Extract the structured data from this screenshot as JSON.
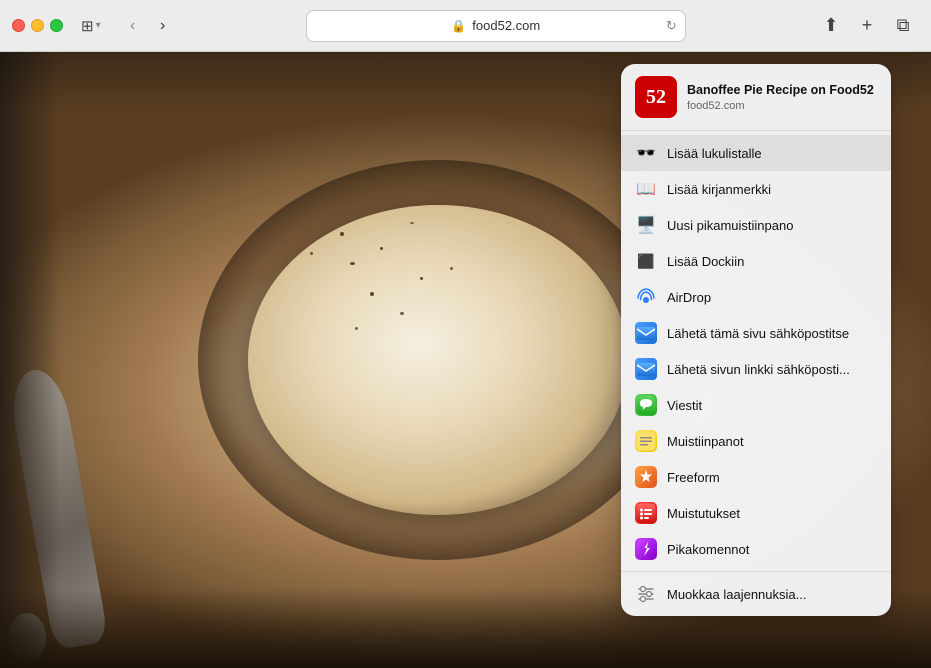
{
  "browser": {
    "url": "food52.com",
    "nav": {
      "back_label": "‹",
      "forward_label": "›"
    }
  },
  "toolbar": {
    "share_label": "⬆",
    "new_tab_label": "+",
    "tab_view_label": "⧉",
    "sidebar_label": "⊞",
    "sidebar_dropdown": "▾"
  },
  "page_preview": {
    "icon_text": "52",
    "title": "Banoffee Pie Recipe on Food52",
    "url": "food52.com"
  },
  "menu": {
    "items": [
      {
        "id": "reading-list",
        "label": "Lisää lukulistalle",
        "icon_type": "glasses",
        "highlighted": true
      },
      {
        "id": "bookmark",
        "label": "Lisää kirjanmerkki",
        "icon_type": "book"
      },
      {
        "id": "quick-note",
        "label": "Uusi pikamuistiinpano",
        "icon_type": "monitor"
      },
      {
        "id": "add-dock",
        "label": "Lisää Dockiin",
        "icon_type": "dock"
      },
      {
        "id": "airdrop",
        "label": "AirDrop",
        "icon_type": "airdrop"
      },
      {
        "id": "mail-page",
        "label": "Lähetä tämä sivu sähköpostitse",
        "icon_type": "mail-page"
      },
      {
        "id": "mail-link",
        "label": "Lähetä sivun linkki sähköposti...",
        "icon_type": "mail-link"
      },
      {
        "id": "messages",
        "label": "Viestit",
        "icon_type": "messages"
      },
      {
        "id": "notes",
        "label": "Muistiinpanot",
        "icon_type": "notes"
      },
      {
        "id": "freeform",
        "label": "Freeform",
        "icon_type": "freeform"
      },
      {
        "id": "reminders",
        "label": "Muistutukset",
        "icon_type": "reminders"
      },
      {
        "id": "shortcuts",
        "label": "Pikakomennot",
        "icon_type": "shortcuts"
      },
      {
        "id": "separator",
        "label": "",
        "icon_type": "separator"
      },
      {
        "id": "customize",
        "label": "Muokkaa laajennuksia...",
        "icon_type": "edit"
      }
    ]
  }
}
